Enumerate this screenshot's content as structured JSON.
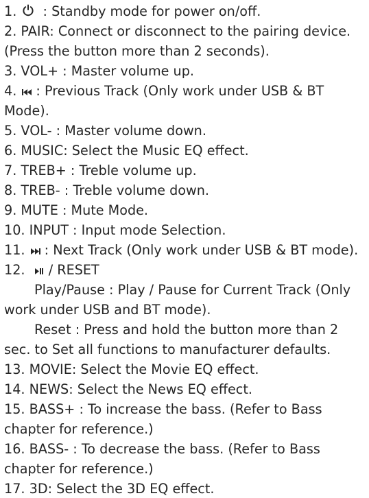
{
  "items": [
    {
      "pre": "1.",
      "icon": "power-icon",
      "post": " : Standby mode for power on/off."
    },
    {
      "text": "2. PAIR: Connect or disconnect to the pairing device."
    },
    {
      "text": "(Press the button more than 2 seconds)."
    },
    {
      "text": "3. VOL+ : Master volume up."
    },
    {
      "pre": "4.",
      "icon": "previous-track-icon",
      "post": ": Previous Track (Only work under USB & BT"
    },
    {
      "text": "Mode)."
    },
    {
      "text": "5. VOL- : Master volume down."
    },
    {
      "text": "6. MUSIC: Select the Music EQ effect."
    },
    {
      "text": "7. TREB+ : Treble volume up."
    },
    {
      "text": "8. TREB- : Treble volume down."
    },
    {
      "text": "9. MUTE : Mute Mode."
    },
    {
      "text": "10. INPUT : Input mode Selection."
    },
    {
      "pre": "11.",
      "icon": "next-track-icon",
      "post": ": Next Track (Only work under USB & BT mode)."
    },
    {
      "pre": "12.",
      "icon": "play-pause-icon",
      "post": " / RESET"
    },
    {
      "text": "Play/Pause : Play / Pause for Current Track (Only"
    },
    {
      "text": "work under USB and BT mode)."
    },
    {
      "text": "Reset : Press and hold the button more than 2"
    },
    {
      "text": "sec. to Set all functions to manufacturer defaults."
    },
    {
      "text": "13. MOVIE: Select the Movie EQ effect."
    },
    {
      "text": "14. NEWS: Select the News EQ effect."
    },
    {
      "text": "15. BASS+ : To increase the bass. (Refer to Bass"
    },
    {
      "text": "chapter for reference.)"
    },
    {
      "text": "16. BASS- : To decrease the bass. (Refer to Bass"
    },
    {
      "text": "chapter for reference.)"
    },
    {
      "text": "17. 3D: Select the 3D EQ effect."
    }
  ]
}
